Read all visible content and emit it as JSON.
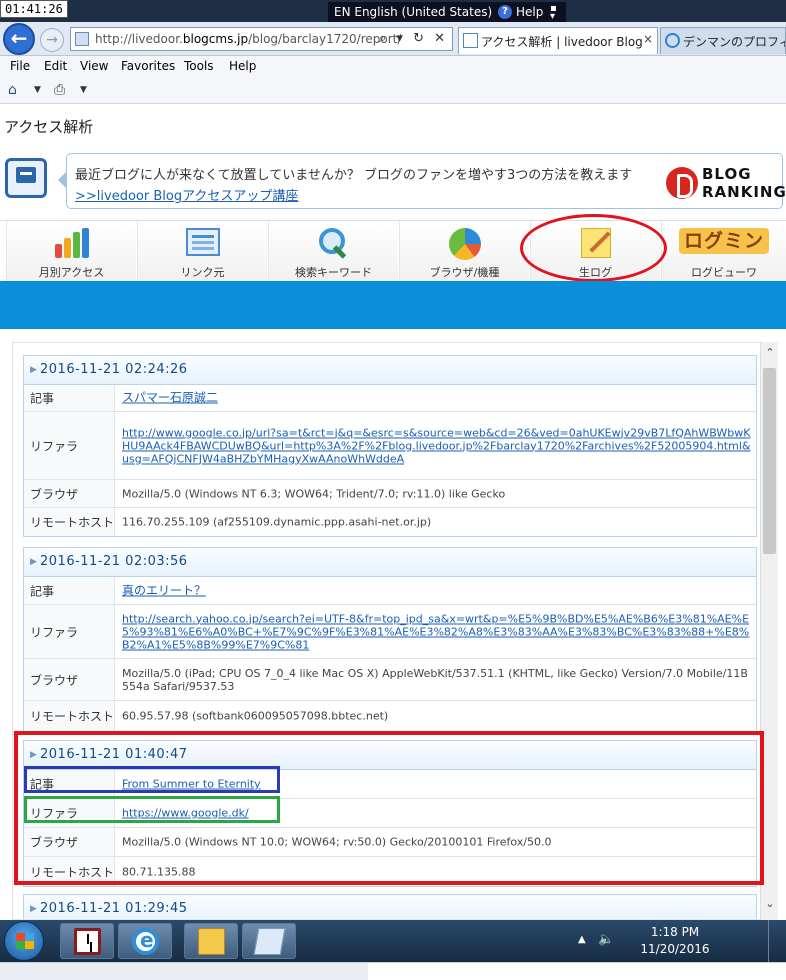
{
  "clock_overlay": "01:41:26",
  "langbar": {
    "language": "EN English (United States)",
    "help": "Help"
  },
  "browser": {
    "url_prefix": "http://livedoor.",
    "url_domain": "blogcms.jp",
    "url_path": "/blog/barclay1720/report/",
    "url_controls": "⌕ ▾ ↻ ✕",
    "tabs": [
      {
        "title": "アクセス解析 | livedoor Blog",
        "close": "×"
      },
      {
        "title": "デンマンのプロフィ"
      }
    ],
    "menu": [
      "File",
      "Edit",
      "View",
      "Favorites",
      "Tools",
      "Help"
    ]
  },
  "page": {
    "title": "アクセス解析",
    "promo_text": "最近ブログに人が来なくて放置していませんか？ ブログのファンを増やす3つの方法を教えます",
    "promo_link": ">>livedoor Blogアクセスアップ講座",
    "ranking_line1": "BLOG",
    "ranking_line2": "RANKING",
    "nav_tabs": [
      {
        "label": "月別アクセス"
      },
      {
        "label": "リンク元"
      },
      {
        "label": "検索キーワード"
      },
      {
        "label": "ブラウザ/機種"
      },
      {
        "label": "生ログ"
      },
      {
        "label": "ログビューワ",
        "logo_text": "ログミン"
      }
    ]
  },
  "field_labels": {
    "article": "記事",
    "referrer": "リファラ",
    "browser": "ブラウザ",
    "remote_host": "リモートホスト"
  },
  "log_entries": [
    {
      "timestamp": "2016-11-21 02:24:26",
      "article": "スパマー石原誠二",
      "referrer": "http://www.google.co.jp/url?sa=t&rct=j&q=&esrc=s&source=web&cd=26&ved=0ahUKEwjv29vB7LfQAhWBWbwKHU9AAck4FBAWCDUwBQ&url=http%3A%2F%2Fblog.livedoor.jp%2Fbarclay1720%2Farchives%2F52005904.html&usg=AFQjCNFJW4aBHZbYMHagyXwAAnoWhWddeA",
      "browser": "Mozilla/5.0 (Windows NT 6.3; WOW64; Trident/7.0; rv:11.0) like Gecko",
      "remote_host": "116.70.255.109 (af255109.dynamic.ppp.asahi-net.or.jp)"
    },
    {
      "timestamp": "2016-11-21 02:03:56",
      "article": "真のエリート？",
      "referrer": "http://search.yahoo.co.jp/search?ei=UTF-8&fr=top_ipd_sa&x=wrt&p=%E5%9B%BD%E5%AE%B6%E3%81%AE%E5%93%81%E6%A0%BC+%E7%9C%9F%E3%81%AE%E3%82%A8%E3%83%AA%E3%83%BC%E3%83%88+%E8%B2%A1%E5%8B%99%E7%9C%81",
      "browser": "Mozilla/5.0 (iPad; CPU OS 7_0_4 like Mac OS X) AppleWebKit/537.51.1 (KHTML, like Gecko) Version/7.0 Mobile/11B554a Safari/9537.53",
      "remote_host": "60.95.57.98 (softbank060095057098.bbtec.net)"
    },
    {
      "timestamp": "2016-11-21 01:40:47",
      "article": "From Summer to Eternity",
      "referrer": "https://www.google.dk/",
      "browser": "Mozilla/5.0 (Windows NT 10.0; WOW64; rv:50.0) Gecko/20100101 Firefox/50.0",
      "remote_host": "80.71.135.88"
    },
    {
      "timestamp": "2016-11-21 01:29:45"
    }
  ],
  "taskbar": {
    "time": "1:18 PM",
    "date": "11/20/2016",
    "tray_up": "▲",
    "volume": "🔈"
  },
  "colors": {
    "accent_band": "#0b8fda",
    "annotation_red": "#e0141d",
    "annotation_blue": "#2a3bb5",
    "annotation_green": "#2aa845"
  }
}
